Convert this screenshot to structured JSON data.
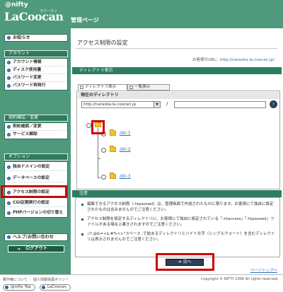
{
  "header": {
    "brand_top": "@nifty",
    "brand_main": "LaCoocan",
    "brand_kana": "ラクーカン",
    "section_title": "管理ページ"
  },
  "sidebar": {
    "notice": "お知らせ",
    "account_head": "アカウント",
    "account_items": [
      "アカウント情報",
      "ディスク使用量",
      "パスワード変更",
      "パスワード再発行"
    ],
    "contract_head": "契約確認／変更",
    "contract_items": [
      "契約確認／変更",
      "サービス解除"
    ],
    "option_head": "オプション",
    "option_items": [
      "独自ドメインの設定",
      "データベースの設定",
      "アクセス制限の設定",
      "CGI定期実行の設定",
      "PHPバージョンの切り替え"
    ],
    "help": "ヘルプ/お問い合わせ",
    "logout": "ログアウト"
  },
  "main": {
    "page_title": "アクセス制限の設定",
    "url_label": "お客様のURL：",
    "url_value": "http://naraoka.la.coocan.jp/",
    "section_dir": "ディレクトリ表示",
    "tabs": [
      "ディレクトリ表示",
      "一覧表示"
    ],
    "panel_title": "現在のディレクトリ",
    "select_value": "http://naraoka.la.coocan.jp",
    "path_sep": "/",
    "dirs": [
      "/dir-1",
      "/dir-2",
      "/dir-3"
    ],
    "section_note": "注意",
    "notes": [
      "編集できるアクセス制限（.htpasswd）は、管理画面で作成されたものに限ります。お客様にて独自に設定されたものは含みませんのでご注意ください。",
      "アクセス制限を設定するディレクトリに、お客様にて独自に設定されている「.htaccess」「.htpasswd」ファイルがある場合上書きされますのでご注意ください。",
      ";/?:@&=+$,#%<>\"スペース   ,で始まるディレクトリとバイト文字（シングルクォート）を含むディレクトリは表示されませんのでご注意ください。"
    ],
    "next": "次へ",
    "page_top": "ページトップへ"
  },
  "footer": {
    "links": "著作権について ｜ 個人情報保護ポリシー",
    "copyright": "Copyright © NIFTY 2006 All rights reserved.",
    "logos": [
      "@nifty Top",
      "LaCoocan"
    ]
  }
}
